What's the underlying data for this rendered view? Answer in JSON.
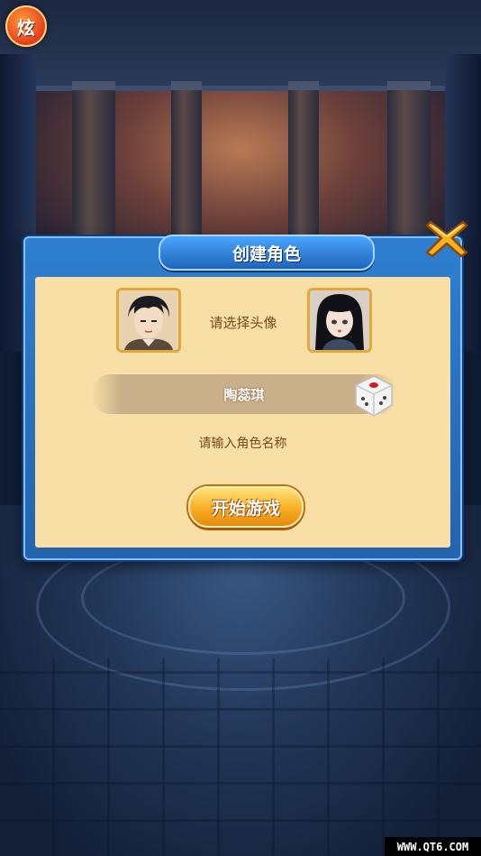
{
  "badge": {
    "label": "炫"
  },
  "dialog": {
    "title": "创建角色",
    "avatar_prompt": "请选择头像",
    "character_name": "陶蕊琪",
    "name_prompt": "请输入角色名称",
    "start_button": "开始游戏"
  },
  "icons": {
    "close": "close-x-icon",
    "dice": "dice-icon",
    "avatar_male": "male-avatar-icon",
    "avatar_female": "female-avatar-icon"
  },
  "watermark": "WWW.QT6.COM",
  "colors": {
    "panel_blue": "#2f7fd0",
    "panel_inner": "#f7dfa6",
    "accent_orange": "#f6a91e",
    "text_brown": "#7a4a18"
  }
}
